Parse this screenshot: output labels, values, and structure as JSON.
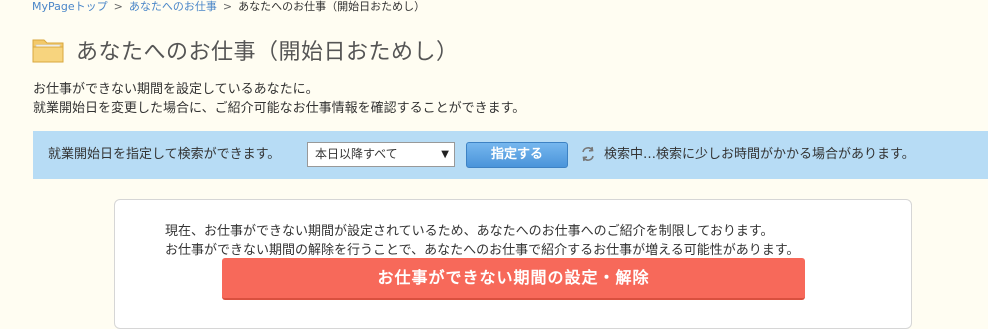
{
  "breadcrumb": {
    "home": "MyPageトップ",
    "jobs": "あなたへのお仕事",
    "current": "あなたへのお仕事（開始日おためし）",
    "separator": ">"
  },
  "header": {
    "title": "あなたへのお仕事（開始日おためし）",
    "icon": "folder-icon"
  },
  "intro": {
    "line1": "お仕事ができない期間を設定しているあなたに。",
    "line2": "就業開始日を変更した場合に、ご紹介可能なお仕事情報を確認することができます。"
  },
  "search": {
    "label": "就業開始日を指定して検索ができます。",
    "selected_option": "本日以降すべて",
    "button_label": "指定する",
    "status_icon": "refresh-icon",
    "status_text": "検索中…検索に少しお時間がかかる場合があります。"
  },
  "notice": {
    "line1": "現在、お仕事ができない期間が設定されているため、あなたへのお仕事へのご紹介を制限しております。",
    "line2": "お仕事ができない期間の解除を行うことで、あなたへのお仕事で紹介するお仕事が増える可能性があります。",
    "button_label": "お仕事ができない期間の設定・解除"
  },
  "colors": {
    "background": "#fffdf2",
    "link": "#4a86c8",
    "search_bar": "#b7dcf5",
    "primary_button": "#4a94da",
    "danger_button": "#f7695a"
  }
}
